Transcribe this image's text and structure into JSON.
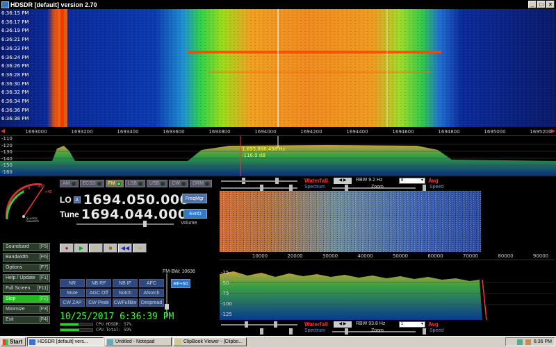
{
  "window": {
    "title": "HDSDR [default]  version 2.70"
  },
  "waterfall": {
    "times": [
      "6:36:15 PM",
      "6:36:17 PM",
      "6:36:19 PM",
      "6:36:21 PM",
      "6:36:23 PM",
      "6:36:24 PM",
      "6:36:26 PM",
      "6:36:28 PM",
      "6:36:30 PM",
      "6:36:32 PM",
      "6:36:34 PM",
      "6:36:36 PM",
      "6:36:38 PM"
    ],
    "freq_labels": [
      "1693000",
      "1693200",
      "1693400",
      "1693600",
      "1693800",
      "1694000",
      "1694200",
      "1694400",
      "1694600",
      "1694800",
      "1695000",
      "1695200"
    ]
  },
  "spectrum": {
    "db_labels": [
      "-110",
      "-120",
      "-130",
      "-140",
      "-150",
      "-160"
    ],
    "cursor_freq": "1,693,888,498 Hz",
    "cursor_level": "-116.9 dB"
  },
  "modes": [
    {
      "label": "AM",
      "active": false
    },
    {
      "label": "ECSS",
      "active": false
    },
    {
      "label": "FM",
      "active": true
    },
    {
      "label": "LSB",
      "active": false
    },
    {
      "label": "USB",
      "active": false
    },
    {
      "label": "CW",
      "active": false
    },
    {
      "label": "DRM",
      "active": false
    }
  ],
  "tuning": {
    "lo_label": "LO",
    "lo_badge": "A",
    "lo_freq": "1694.050.000",
    "tune_label": "Tune",
    "tune_freq": "1694.044.000",
    "freqmgr": "FreqMgr",
    "extio": "ExtIO",
    "volume_label": "Volume"
  },
  "smeter": {
    "label": "S-units\nSquelch",
    "scale": [
      "1",
      "3",
      "5",
      "7",
      "9",
      "+20",
      "+40"
    ]
  },
  "fkeys": [
    {
      "label": "Soundcard",
      "key": "[F5]"
    },
    {
      "label": "Bandwidth",
      "key": "[F6]"
    },
    {
      "label": "Options",
      "key": "[F7]"
    },
    {
      "label": "Help / Update",
      "key": "[F1]"
    },
    {
      "label": "Full Screen",
      "key": "[F11]"
    },
    {
      "label": "Stop",
      "key": "[F2]"
    },
    {
      "label": "Minimize",
      "key": "[F3]"
    },
    {
      "label": "Exit",
      "key": "[F4]"
    }
  ],
  "transport": [
    "●",
    "▶",
    "II",
    "■",
    "◀◀",
    "∞"
  ],
  "dsp": [
    "NR",
    "NB RF",
    "NB IF",
    "AFC",
    "Mute",
    "AGC Off",
    "Notch",
    "ANotch",
    "CW ZAP",
    "CW Peak",
    "CWFullBw",
    "Despread"
  ],
  "fm_bw": "FM-BW: 10636",
  "rf_btn": "RF+50",
  "datetime": "10/25/2017  6:36:39 PM",
  "cpu": [
    {
      "label": "CPU HDSDR:",
      "value": "57%",
      "level": 0.57
    },
    {
      "label": "CPU Total:",
      "value": "59%",
      "level": 0.59
    }
  ],
  "af_controls": {
    "waterfall": "Waterfall",
    "spectrum": "Spectrum",
    "rbw_top": "RBW  9.2 Hz",
    "rbw_bottom": "RBW  93.8 Hz",
    "avg": "Avg",
    "zoom": "Zoom",
    "speed": "Speed",
    "avg_top": "8",
    "avg_bottom": "1"
  },
  "af_axis": [
    "10000",
    "20000",
    "30000",
    "40000",
    "50000",
    "60000",
    "70000",
    "80000",
    "90000"
  ],
  "af_db": [
    "-25",
    "-50",
    "-75",
    "-100",
    "-125"
  ],
  "taskbar": {
    "start": "Start",
    "items": [
      "HDSDR [default] vers...",
      "Untitled - Notepad",
      "ClipBook Viewer - [Clipbo..."
    ],
    "clock": "6:36 PM"
  },
  "colors": {
    "accent": "#2f7ac9",
    "stop_green": "#22bb22",
    "datetime_green": "#33ff33",
    "cursor_yellow": "#ffff33"
  }
}
